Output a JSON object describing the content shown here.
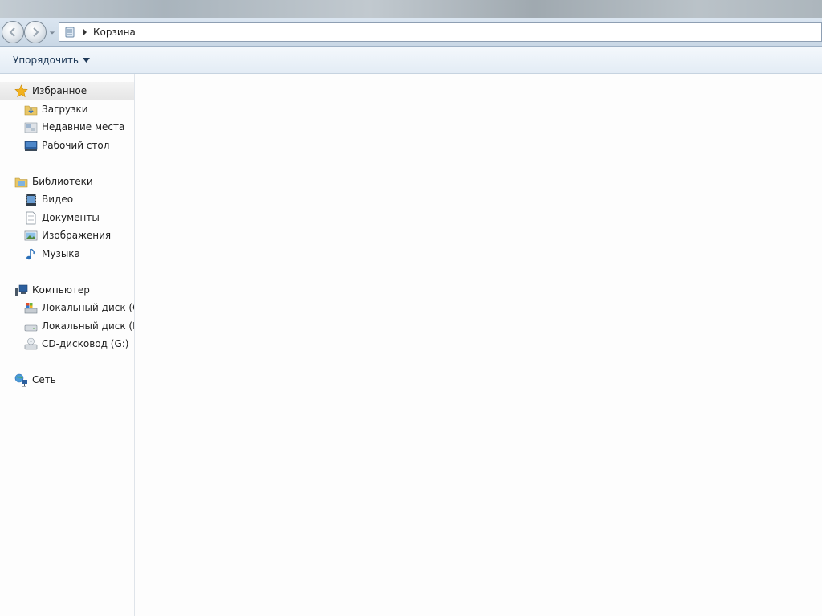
{
  "address": {
    "path": [
      "Корзина"
    ]
  },
  "toolbar": {
    "organize_label": "Упорядочить"
  },
  "nav": {
    "favorites": {
      "label": "Избранное",
      "items": [
        {
          "label": "Загрузки",
          "icon": "downloads-icon"
        },
        {
          "label": "Недавние места",
          "icon": "recent-places-icon"
        },
        {
          "label": "Рабочий стол",
          "icon": "desktop-icon"
        }
      ]
    },
    "libraries": {
      "label": "Библиотеки",
      "items": [
        {
          "label": "Видео",
          "icon": "video-icon"
        },
        {
          "label": "Документы",
          "icon": "documents-icon"
        },
        {
          "label": "Изображения",
          "icon": "pictures-icon"
        },
        {
          "label": "Музыка",
          "icon": "music-icon"
        }
      ]
    },
    "computer": {
      "label": "Компьютер",
      "items": [
        {
          "label": "Локальный диск (C:)",
          "icon": "system-drive-icon"
        },
        {
          "label": "Локальный диск (D:)",
          "icon": "drive-icon"
        },
        {
          "label": "CD-дисковод (G:)",
          "icon": "cd-drive-icon"
        }
      ]
    },
    "network": {
      "label": "Сеть"
    }
  },
  "colors": {
    "toolbar_text": "#1e3957",
    "selected_row": "#e6e6e6",
    "star": "#f2b21f",
    "folder": "#e9c768"
  }
}
